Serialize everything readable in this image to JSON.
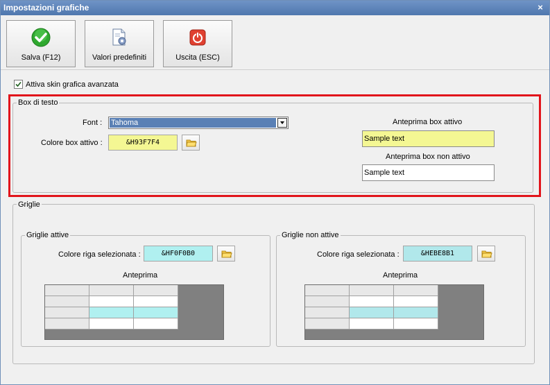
{
  "window": {
    "title": "Impostazioni grafiche",
    "close_glyph": "×"
  },
  "toolbar": {
    "buttons": [
      {
        "label": "Salva (F12)",
        "icon": "check-circle-icon"
      },
      {
        "label": "Valori predefiniti",
        "icon": "document-gear-icon"
      },
      {
        "label": "Uscita (ESC)",
        "icon": "power-icon"
      }
    ]
  },
  "skin": {
    "label": "Attiva skin grafica avanzata",
    "checked": true
  },
  "box_di_testo": {
    "legend": "Box di testo",
    "font_label": "Font :",
    "font_value": "Tahoma",
    "colore_label": "Colore box attivo :",
    "colore_value": "&H93F7F4",
    "colore_hex": "#f4f793",
    "preview_active_label": "Anteprima box attivo",
    "preview_active_text": "Sample text",
    "preview_inactive_label": "Anteprima box non attivo",
    "preview_inactive_text": "Sample text"
  },
  "griglie": {
    "legend": "Griglie",
    "attive": {
      "legend": "Griglie attive",
      "colore_label": "Colore riga selezionata :",
      "colore_value": "&HF0F0B0",
      "colore_hex": "#b0f0f0",
      "preview_label": "Anteprima"
    },
    "non_attive": {
      "legend": "Griglie non attive",
      "colore_label": "Colore riga selezionata :",
      "colore_value": "&HEBE8B1",
      "colore_hex": "#b1e8eb",
      "preview_label": "Anteprima"
    }
  },
  "colors": {
    "highlight_border": "#e1141b",
    "combo_selected": "#5a80b5"
  }
}
